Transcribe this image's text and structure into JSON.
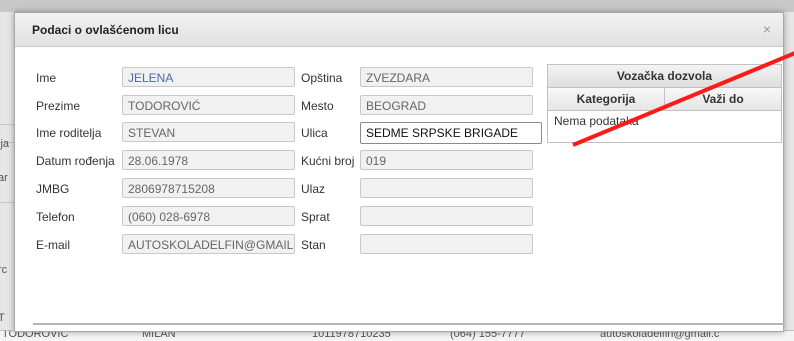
{
  "dialog": {
    "title": "Podaci o ovlašćenom licu",
    "close_icon_glyph": "×"
  },
  "left_fields": [
    {
      "label": "Ime",
      "value": "JELENA"
    },
    {
      "label": "Prezime",
      "value": "TODOROVIĆ"
    },
    {
      "label": "Ime roditelja",
      "value": "STEVAN"
    },
    {
      "label": "Datum rođenja",
      "value": "28.06.1978"
    },
    {
      "label": "JMBG",
      "value": "2806978715208"
    },
    {
      "label": "Telefon",
      "value": "(060) 028-6978"
    },
    {
      "label": "E-mail",
      "value": "AUTOSKOLADELFIN@GMAIL"
    }
  ],
  "right_fields": [
    {
      "label": "Opština",
      "value": "ZVEZDARA"
    },
    {
      "label": "Mesto",
      "value": "BEOGRAD"
    },
    {
      "label": "Ulica",
      "value": "SEDME SRPSKE BRIGADE"
    },
    {
      "label": "Kućni broj",
      "value": "019"
    },
    {
      "label": "Ulaz",
      "value": ""
    },
    {
      "label": "Sprat",
      "value": ""
    },
    {
      "label": "Stan",
      "value": ""
    }
  ],
  "license": {
    "title": "Vozačka dozvola",
    "col_category": "Kategorija",
    "col_valid_until": "Važi do",
    "empty_text": "Nema podataka"
  },
  "background": {
    "left_fragments": [
      "lja",
      "ar",
      "rc",
      "T"
    ],
    "bottom_row": [
      "TODOROVIĆ",
      "MILAN",
      "1011978710235",
      "(064) 155-7777",
      "autoskoladelfin@gmail.c"
    ]
  },
  "colors": {
    "annotation_line": "#ff1a1a",
    "field_value_blue": "#4a6b9c"
  },
  "icons": {
    "close": "close-icon"
  }
}
